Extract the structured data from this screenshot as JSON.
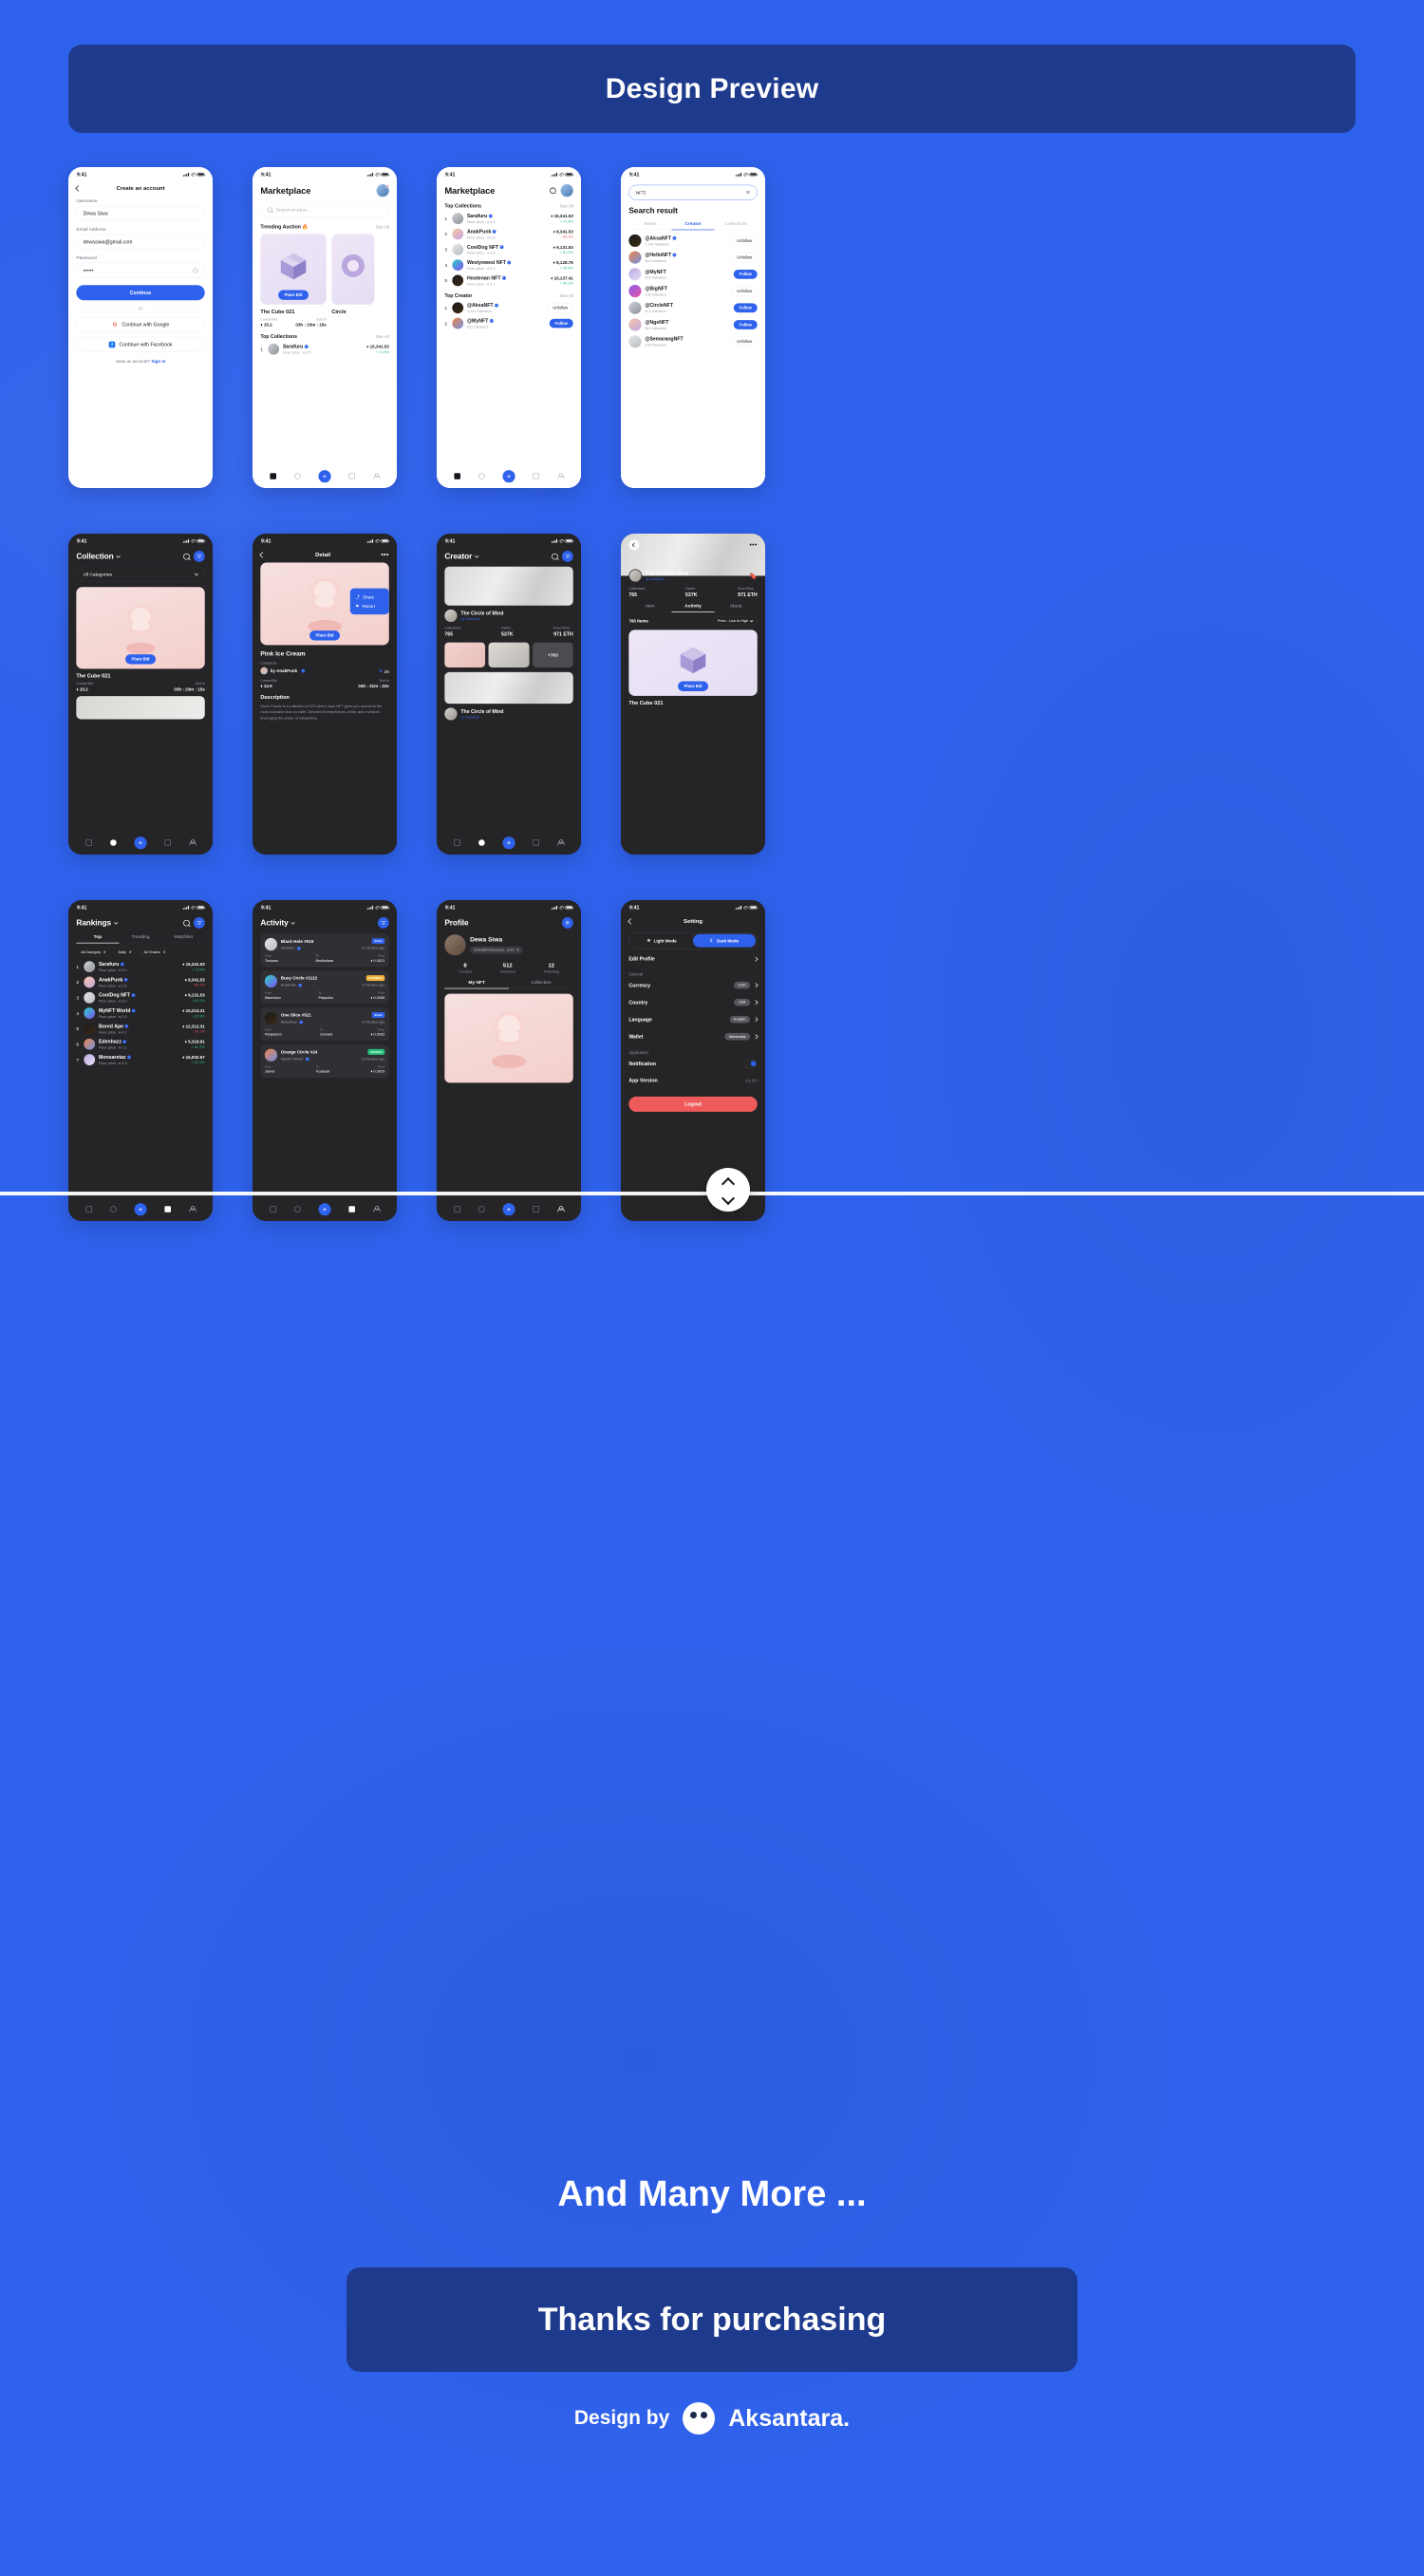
{
  "banner": {
    "title": "Design Preview"
  },
  "footer": {
    "many_more": "And Many More ...",
    "thanks": "Thanks for purchasing",
    "design_by": "Design by",
    "author": "Aksantara."
  },
  "status_bar": {
    "time": "9:41"
  },
  "screens": {
    "signup": {
      "title": "Create an account",
      "username_label": "Username",
      "username_value": "Dewa Siwa",
      "email_label": "Email Address",
      "email_value": "dewasiwa@gmail.com",
      "password_label": "Password",
      "password_value": "••••••",
      "continue_label": "Continue",
      "or": "Or",
      "google_label": "Continue with Google",
      "facebook_label": "Continue with Facebook",
      "have_account": "Have an account?",
      "signin": "Sign In"
    },
    "marketplace_light": {
      "title": "Marketplace",
      "search_placeholder": "Search product ...",
      "trending_title": "Trending Auction 🔥",
      "see_all": "See All",
      "auction": {
        "name": "The Cube 021",
        "place_bid": "Place Bid",
        "current_bid_label": "Current Bid",
        "current_bid_value": "15.2",
        "end_in_label": "End in",
        "end_in_value": "03h : 23m : 15s"
      },
      "auction2_name": "Circle",
      "collections_title": "Top Collections",
      "collections": [
        {
          "rank": "1",
          "name": "Sarafuru",
          "floor_label": "Floor price :",
          "floor": "3.5",
          "value": "15,341.53",
          "change": "+ 71.9%",
          "dir": "up"
        }
      ]
    },
    "marketplace_collections": {
      "title": "Marketplace",
      "top_collections": "Top Collections",
      "see_all": "See All",
      "collections": [
        {
          "rank": "1",
          "name": "Sarafuru",
          "floor_label": "Floor price :",
          "floor": "3.5",
          "value": "15,341.53",
          "change": "+ 71.9%",
          "dir": "up"
        },
        {
          "rank": "2",
          "name": "AnakPunk",
          "floor_label": "Floor price :",
          "floor": "2.6",
          "value": "8,341.53",
          "change": "- 64.1%",
          "dir": "down"
        },
        {
          "rank": "3",
          "name": "CoolDog NFT",
          "floor_label": "Floor price :",
          "floor": "3.9",
          "value": "9,131.53",
          "change": "+ 81.2%",
          "dir": "up"
        },
        {
          "rank": "4",
          "name": "Wesiyowesi NFT",
          "floor_label": "Floor price :",
          "floor": "3.2",
          "value": "8,128.76",
          "change": "+ 45.6%",
          "dir": "up"
        },
        {
          "rank": "5",
          "name": "Hootenan NFT",
          "floor_label": "Floor price :",
          "floor": "3.1",
          "value": "10,137.41",
          "change": "+ 54.1%",
          "dir": "up"
        }
      ],
      "top_creator": "Top Creator",
      "creators": [
        {
          "rank": "1",
          "handle": "@AksaNFT",
          "followers": "1.241 followers",
          "action": "Unfollow",
          "following": true
        },
        {
          "rank": "2",
          "handle": "@MyNFT",
          "followers": "622 followers",
          "action": "Follow",
          "following": false
        }
      ]
    },
    "search": {
      "query": "NFT|",
      "heading": "Search result",
      "tabs": [
        "Items",
        "Creator",
        "Collections"
      ],
      "active_tab": "Creator",
      "results": [
        {
          "handle": "@AksaNFT",
          "followers": "1.241 followers",
          "verified": true,
          "action": "Unfollow",
          "following": true
        },
        {
          "handle": "@HelloNFT",
          "followers": "812 followers",
          "verified": true,
          "action": "Unfollow",
          "following": true
        },
        {
          "handle": "@MyNFT",
          "followers": "622 followers",
          "verified": false,
          "action": "Follow",
          "following": false
        },
        {
          "handle": "@BigNFT",
          "followers": "192 followers",
          "verified": false,
          "action": "Unfollow",
          "following": true
        },
        {
          "handle": "@CircleNFT",
          "followers": "412 followers",
          "verified": false,
          "action": "Follow",
          "following": false
        },
        {
          "handle": "@NgeNFT",
          "followers": "812 followers",
          "verified": false,
          "action": "Follow",
          "following": false
        },
        {
          "handle": "@SemarangNFT",
          "followers": "192 followers",
          "verified": false,
          "action": "Unfollow",
          "following": true
        }
      ]
    },
    "collection": {
      "title": "Collection",
      "filter_value": "All Categories",
      "card": {
        "place_bid": "Place Bid",
        "name": "The Cube 021",
        "current_bid_label": "Current Bid",
        "current_bid_value": "15.2",
        "end_in_label": "End in",
        "end_in_value": "03h : 23m : 15s"
      }
    },
    "detail": {
      "title": "Detail",
      "menu": {
        "share": "Share",
        "report": "Report"
      },
      "place_bid": "Place Bid",
      "name": "Pink Ice Cream",
      "created_by_label": "Created by",
      "creator": "by AnakPunk",
      "likes": "28",
      "current_bid_label": "Current Bid",
      "current_bid_value": "12.9",
      "end_in_label": "End in",
      "end_in_value": "04h : 31m : 22s",
      "description_title": "Description",
      "description": "Circle Puzzle is a collection of 123 where each NFT gives you access to the most exclusive club on earth. Devoted Entrepreneurs, Artist, and Investors leveraging the power of networking."
    },
    "creator": {
      "title": "Creator",
      "name": "The Circle of Mind",
      "by": "by Sarafuru",
      "stats": [
        {
          "k": "Collections",
          "v": "765"
        },
        {
          "k": "Owner",
          "v": "537K"
        },
        {
          "k": "Floor Price",
          "v": "971 ETH"
        }
      ],
      "more_count": "+763",
      "name2": "The Circle of Mind",
      "by2": "by Sarafuru"
    },
    "creator_activity": {
      "name": "The Circle of Mind",
      "by": "by Sarafuru",
      "stats": [
        {
          "k": "Collections",
          "v": "765"
        },
        {
          "k": "Owner",
          "v": "537K"
        },
        {
          "k": "Floor Price",
          "v": "971 ETH"
        }
      ],
      "tabs": [
        "Item",
        "Activity",
        "About"
      ],
      "active_tab": "Activity",
      "items_count": "765 Items",
      "sort": "Price : Low to High",
      "card": {
        "place_bid": "Place Bid",
        "name": "The Cube 021"
      }
    },
    "rankings": {
      "title": "Rankings",
      "tabs": [
        "Top",
        "Trending",
        "Watchlist"
      ],
      "active_tab": "Top",
      "chips": [
        "All Category",
        "Daily",
        "All Chains"
      ],
      "rows": [
        {
          "rank": "1",
          "name": "Sarafuru",
          "floor_label": "Floor price :",
          "floor": "3.5",
          "value": "15,341.53",
          "change": "+ 71.9%",
          "dir": "up"
        },
        {
          "rank": "2",
          "name": "AnakPunk",
          "floor_label": "Floor price :",
          "floor": "2.6",
          "value": "8,341.53",
          "change": "- 64.1%",
          "dir": "down"
        },
        {
          "rank": "3",
          "name": "CoolDog NFT",
          "floor_label": "Floor price :",
          "floor": "3.9",
          "value": "9,131.53",
          "change": "+ 81.2%",
          "dir": "up"
        },
        {
          "rank": "4",
          "name": "MyNFT World",
          "floor_label": "Floor price :",
          "floor": "2.9",
          "value": "10,213.21",
          "change": "+ 92.8%",
          "dir": "up"
        },
        {
          "rank": "5",
          "name": "Bored Ape",
          "floor_label": "Floor price :",
          "floor": "9.1",
          "value": "12,312.31",
          "change": "- 24.1%",
          "dir": "down"
        },
        {
          "rank": "6",
          "name": "Edenhazz",
          "floor_label": "Floor price :",
          "floor": "1.2",
          "value": "5,318.91",
          "change": "+ 81.2%",
          "dir": "up"
        },
        {
          "rank": "7",
          "name": "Monsaretaz",
          "floor_label": "Floor price :",
          "floor": "4.3",
          "value": "15,932.67",
          "change": "+ 81.2%",
          "dir": "up"
        }
      ]
    },
    "activity": {
      "title": "Activity",
      "cards": [
        {
          "name": "Black Hole #015",
          "creator": "Sarafuru",
          "badge": "SALE",
          "time": "2 minutes ago",
          "from_label": "From",
          "from": "Tonoasu",
          "to_label": "To",
          "to": "Bedlindase",
          "price_label": "Price",
          "price": "0.0021"
        },
        {
          "name": "Busy Circle #1122",
          "creator": "Anakhole",
          "badge": "LISTINGS",
          "time": "3 minutes ago",
          "from_label": "From",
          "from": "Wachidun",
          "to_label": "To",
          "to": "Pakpolisi",
          "price_label": "Price",
          "price": "0.0085"
        },
        {
          "name": "One Slice #521",
          "creator": "BoredApe",
          "badge": "SALE",
          "time": "4 minutes ago",
          "from_label": "From",
          "from": "Panjolcem",
          "to_label": "To",
          "to": "Cemani",
          "price_label": "Price",
          "price": "0.0032"
        },
        {
          "name": "Orange Circle #24",
          "creator": "MyNFT World",
          "badge": "OFFERS",
          "time": "9 minutes ago",
          "from_label": "From",
          "from": "Jarnet",
          "to_label": "To",
          "to": "Kudasai",
          "price_label": "Price",
          "price": "0.0029"
        }
      ]
    },
    "profile": {
      "title": "Profile",
      "name": "Dewa Siwa",
      "address": "0xasdafhODaoarazu...a1b2",
      "stats": [
        {
          "v": "8",
          "k": "Created"
        },
        {
          "v": "512",
          "k": "Followers"
        },
        {
          "v": "12",
          "k": "Following"
        }
      ],
      "tabs": [
        "My NFT",
        "Collection"
      ],
      "active_tab": "My NFT"
    },
    "setting": {
      "title": "Setting",
      "light_mode": "Light Mode",
      "dark_mode": "Dark Mode",
      "active_mode": "Dark Mode",
      "edit_profile": "Edit Profile",
      "group_general": "General",
      "group_application": "Application",
      "rows": [
        {
          "name": "Currency",
          "value": "USD"
        },
        {
          "name": "Country",
          "value": "USA"
        },
        {
          "name": "Language",
          "value": "English"
        },
        {
          "name": "Wallet",
          "value": "Metamask"
        }
      ],
      "notification": "Notification",
      "app_version_label": "App Version",
      "app_version": "v.1.0.0",
      "logout": "Logout"
    }
  },
  "colors": {
    "brand": "#2f62ec",
    "banner": "#1e3a8c",
    "dark_surface": "#252528",
    "up": "#27c07a",
    "down": "#ef4d56",
    "logout": "#ef5b5b"
  }
}
